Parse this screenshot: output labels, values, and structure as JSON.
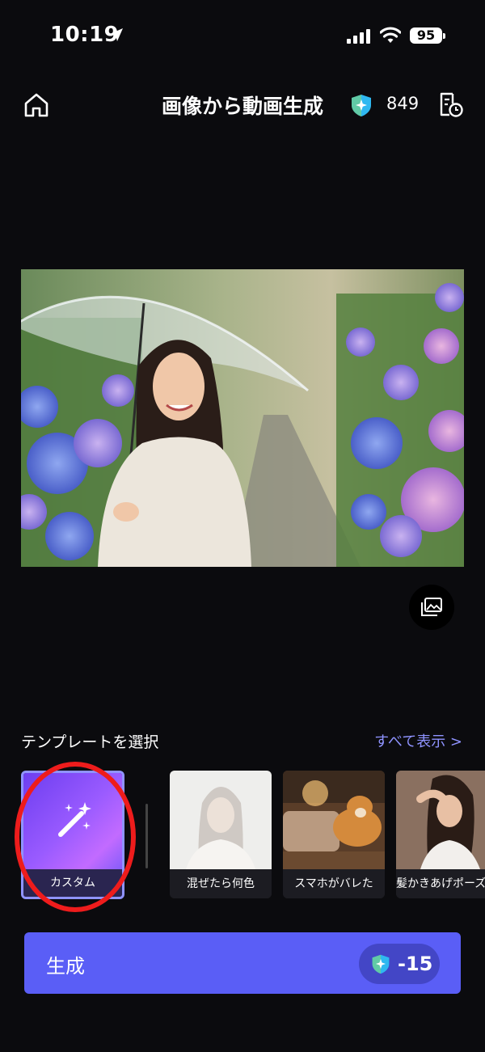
{
  "status_bar": {
    "time": "10:19",
    "battery": "95"
  },
  "header": {
    "title": "画像から動画生成",
    "credits": "849"
  },
  "templates": {
    "section_label": "テンプレートを選択",
    "show_all_label": "すべて表示 >",
    "items": [
      {
        "label": "カスタム",
        "selected": true
      },
      {
        "label": "混ぜたら何色"
      },
      {
        "label": "スマホがバレた"
      },
      {
        "label": "髪かきあげポーズ"
      }
    ]
  },
  "generate": {
    "label": "生成",
    "cost": "-15"
  },
  "colors": {
    "accent": "#5a5ef6",
    "link": "#8f93ff",
    "highlight": "#ee1c1c"
  }
}
